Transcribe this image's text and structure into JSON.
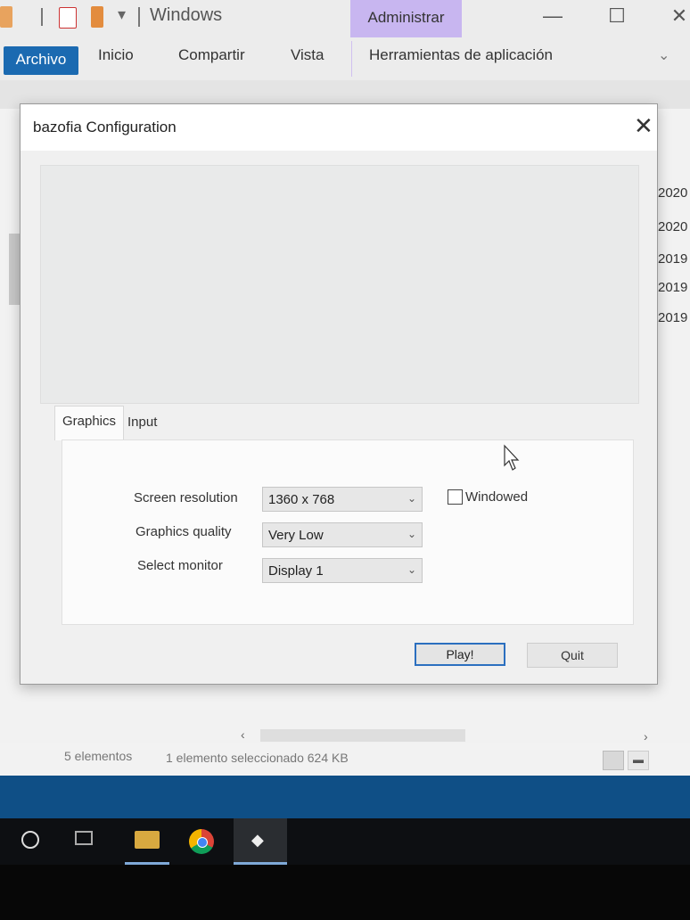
{
  "explorer": {
    "title": "Windows",
    "contextual_tab_group": "Administrar",
    "ribbon_tabs": [
      "Archivo",
      "Inicio",
      "Compartir",
      "Vista",
      "Herramientas de aplicación"
    ],
    "partial_dates": [
      "2020",
      "2020",
      "2019",
      "2019",
      "2019"
    ],
    "status_count": "5 elementos",
    "status_selected": "1 elemento seleccionado  624 KB",
    "colors": {
      "archivo_tab": "#1b6ab1",
      "contextual_tab": "#c8b6f0"
    }
  },
  "dialog": {
    "title": "bazofia Configuration",
    "tabs": [
      "Graphics",
      "Input"
    ],
    "active_tab": "Graphics",
    "fields": [
      {
        "label": "Screen resolution",
        "value": "1360 x 768"
      },
      {
        "label": "Graphics quality",
        "value": "Very Low"
      },
      {
        "label": "Select monitor",
        "value": "Display 1"
      }
    ],
    "windowed_label": "Windowed",
    "windowed_checked": false,
    "play_label": "Play!",
    "quit_label": "Quit"
  },
  "taskbar": {
    "icons": [
      "start-icon",
      "task-view-icon",
      "file-explorer-icon",
      "chrome-icon",
      "unity-icon"
    ]
  }
}
